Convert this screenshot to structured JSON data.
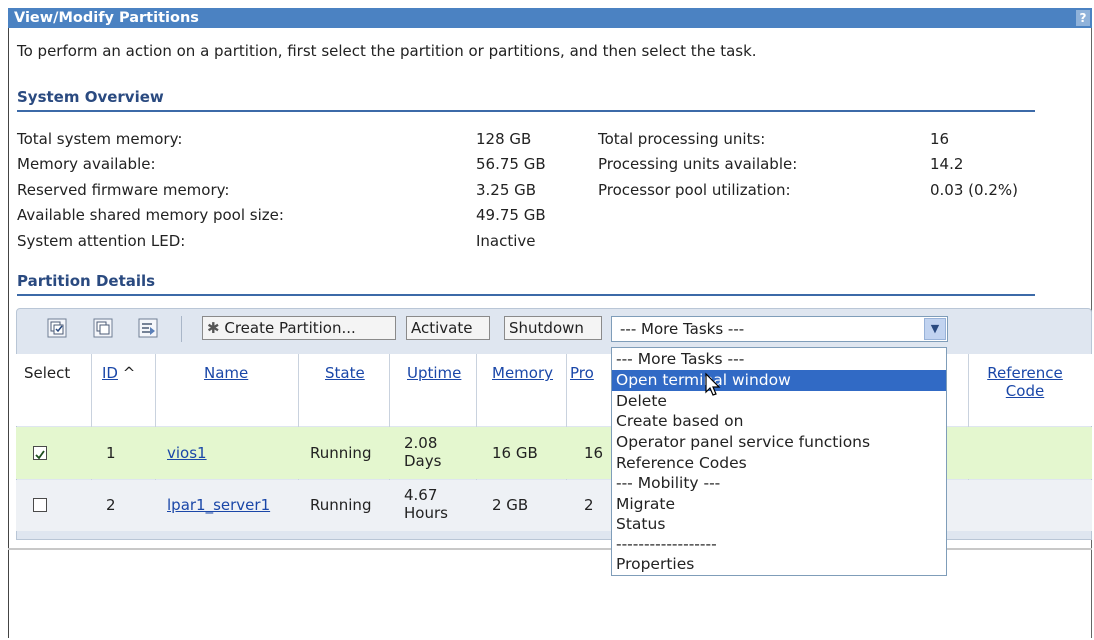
{
  "window": {
    "title": "View/Modify Partitions",
    "help_label": "?"
  },
  "intro": "To perform an action on a partition, first select the partition or partitions, and then select the task.",
  "overview": {
    "heading": "System Overview",
    "left": [
      {
        "label": "Total system memory:",
        "value": "128 GB"
      },
      {
        "label": "Memory available:",
        "value": "56.75 GB"
      },
      {
        "label": "Reserved firmware memory:",
        "value": "3.25 GB"
      },
      {
        "label": "Available shared memory pool size:",
        "value": "49.75 GB"
      },
      {
        "label": "System attention LED:",
        "value": "Inactive"
      }
    ],
    "right": [
      {
        "label": "Total processing units:",
        "value": "16"
      },
      {
        "label": "Processing units available:",
        "value": "14.2"
      },
      {
        "label": "Processor pool utilization:",
        "value": "0.03 (0.2%)"
      }
    ]
  },
  "details": {
    "heading": "Partition Details"
  },
  "toolbar": {
    "create_label": "Create Partition...",
    "activate_label": "Activate",
    "shutdown_label": "Shutdown",
    "more_tasks_value": "--- More Tasks ---"
  },
  "table": {
    "headers": {
      "select": "Select",
      "id": "ID",
      "sort_indicator": "^",
      "name": "Name",
      "state": "State",
      "uptime": "Uptime",
      "memory": "Memory",
      "processors": "Pro",
      "reference_code_1": "Reference",
      "reference_code_2": "Code"
    },
    "rows": [
      {
        "checked": true,
        "id": "1",
        "name": "vios1",
        "state": "Running",
        "uptime_1": "2.08",
        "uptime_2": "Days",
        "memory": "16 GB",
        "processors": "16"
      },
      {
        "checked": false,
        "id": "2",
        "name": "lpar1_server1",
        "state": "Running",
        "uptime_1": "4.67",
        "uptime_2": "Hours",
        "memory": "2 GB",
        "processors": "2"
      }
    ]
  },
  "menu": {
    "items": [
      "--- More Tasks ---",
      "Open terminal window",
      "Delete",
      "Create based on",
      "Operator panel service functions",
      "Reference Codes",
      "--- Mobility ---",
      "Migrate",
      "Status",
      "------------------",
      "Properties"
    ],
    "selected_index": 1
  },
  "colors": {
    "titlebar": "#4b82c2",
    "heading": "#2a4a80",
    "link": "#1a47a8",
    "selected_row": "#e4f7cf",
    "menu_highlight": "#316ac5"
  }
}
